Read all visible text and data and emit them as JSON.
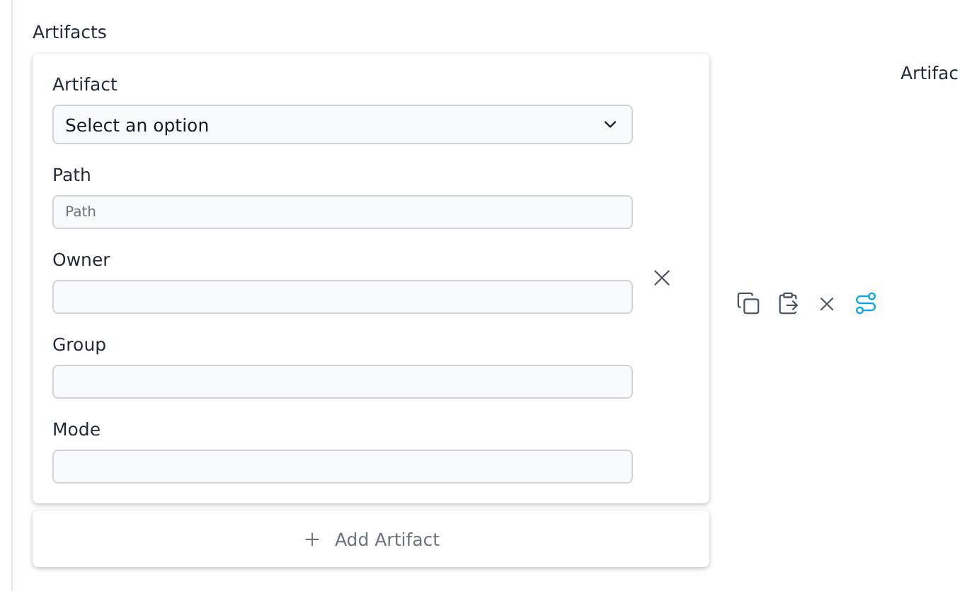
{
  "section_title": "Artifacts",
  "card": {
    "fields": [
      {
        "kind": "select",
        "label": "Artifact",
        "value": "Select an option"
      },
      {
        "kind": "input",
        "label": "Path",
        "placeholder": "Path"
      },
      {
        "kind": "input",
        "label": "Owner"
      },
      {
        "kind": "input",
        "label": "Group"
      },
      {
        "kind": "input",
        "label": "Mode"
      }
    ]
  },
  "add_button": {
    "label": "Add Artifact"
  },
  "side_panel": {
    "title": "Artifac"
  }
}
